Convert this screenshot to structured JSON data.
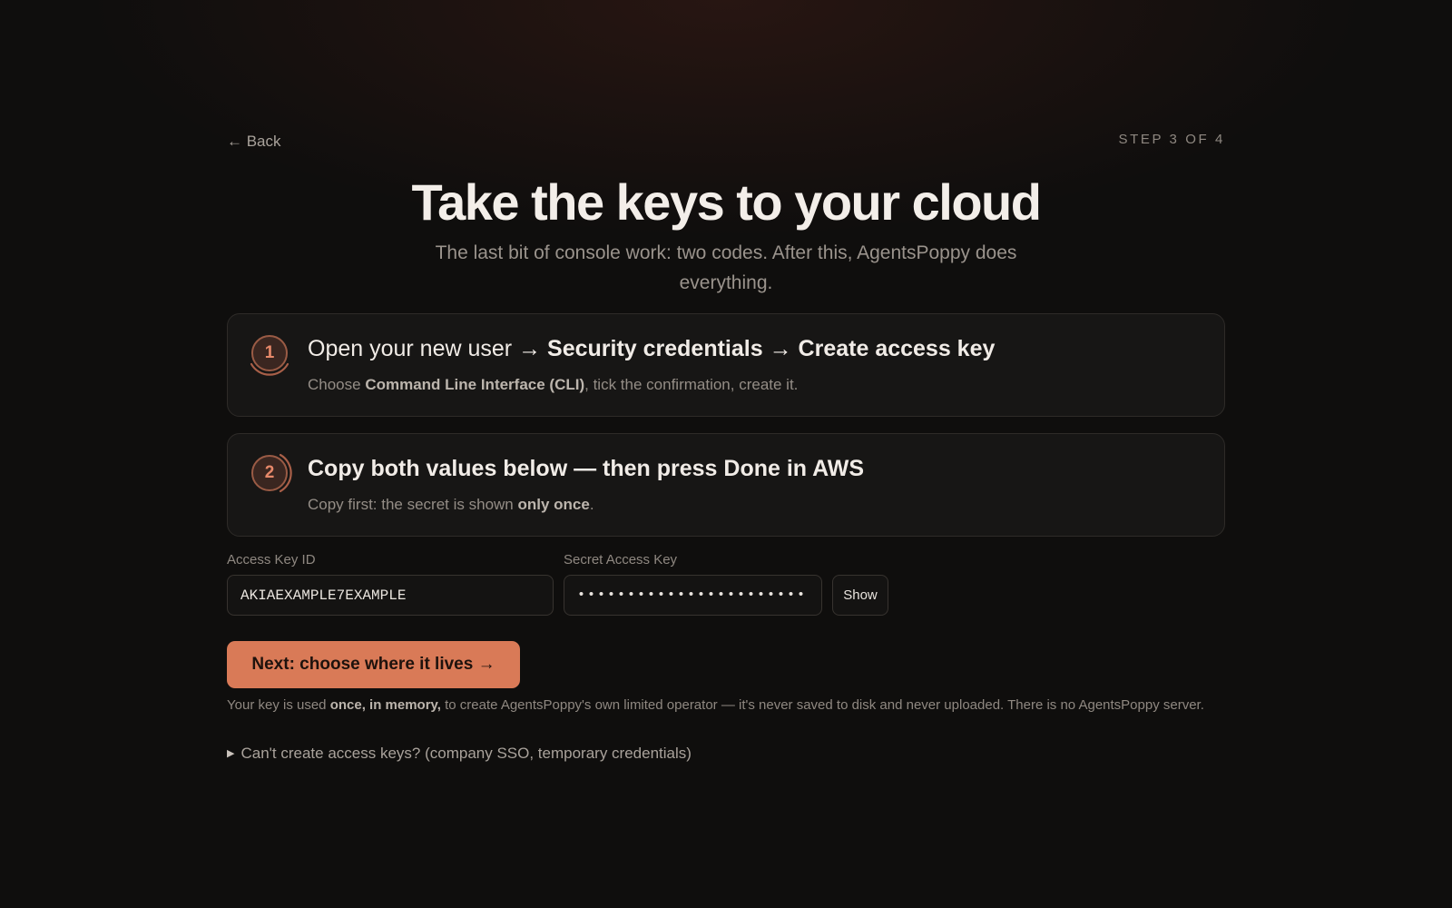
{
  "nav": {
    "back_label": "← Back",
    "step_indicator": "STEP 3 OF 4"
  },
  "header": {
    "title": "Take the keys to your cloud",
    "subtitle": "The last bit of console work: two codes. After this, AgentsPoppy does everything."
  },
  "steps": [
    {
      "number": "1",
      "title_intro": "Open your new user → ",
      "title_strong_1": "Security credentials",
      "title_arrow": " → ",
      "title_strong_2": "Create access key",
      "desc_before": "Choose ",
      "desc_strong": "Command Line Interface (CLI)",
      "desc_after": ", tick the confirmation, create it."
    },
    {
      "number": "2",
      "title": "Copy both values below — then press Done in AWS",
      "desc_before": "Copy first: the secret is shown ",
      "desc_strong": "only once",
      "desc_after": "."
    }
  ],
  "form": {
    "access_key_label": "Access Key ID",
    "access_key_value": "AKIAEXAMPLE7EXAMPLE",
    "secret_key_label": "Secret Access Key",
    "secret_key_masked": "•••••••••••••••••••••••••",
    "show_label": "Show"
  },
  "primary_button": {
    "label": "Next: choose where it lives →"
  },
  "note": {
    "before": "Your key is used ",
    "strong": "once, in memory,",
    "after": " to create AgentsPoppy's own limited operator — it's never saved to disk and never uploaded. There is no AgentsPoppy server."
  },
  "disclosure": {
    "label": "Can't create access keys? (company SSO, temporary credentials)"
  },
  "colors": {
    "accent": "#d97a57",
    "background": "#0f0e0d",
    "card": "#171615",
    "badge_text": "#e7896a"
  },
  "icons": {
    "disclosure": "triangle-right-icon"
  }
}
